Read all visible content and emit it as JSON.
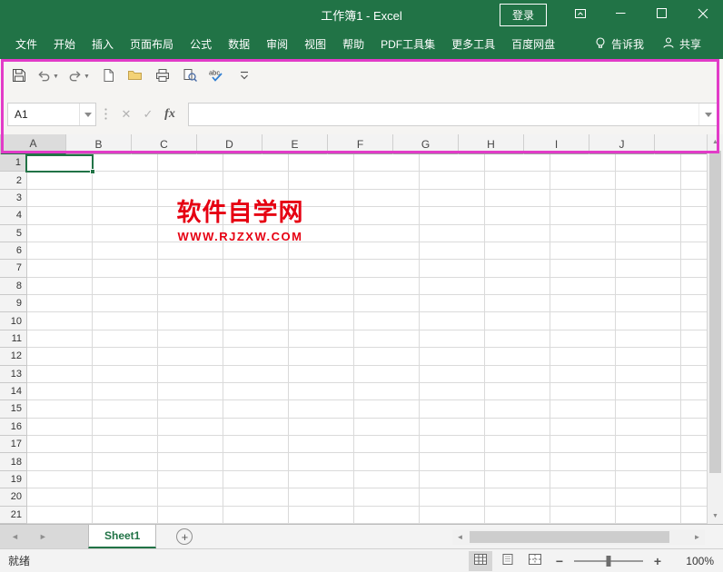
{
  "colors": {
    "accent_green": "#217346",
    "highlight_pink": "#e23bc8",
    "watermark_red": "#e60012"
  },
  "title_bar": {
    "title": "工作簿1 - Excel",
    "login_label": "登录"
  },
  "menu_bar": {
    "tabs": [
      {
        "name": "file",
        "label": "文件"
      },
      {
        "name": "home",
        "label": "开始"
      },
      {
        "name": "insert",
        "label": "插入"
      },
      {
        "name": "page-layout",
        "label": "页面布局"
      },
      {
        "name": "formulas",
        "label": "公式"
      },
      {
        "name": "data",
        "label": "数据"
      },
      {
        "name": "review",
        "label": "审阅"
      },
      {
        "name": "view",
        "label": "视图"
      },
      {
        "name": "help",
        "label": "帮助"
      },
      {
        "name": "pdf-tools",
        "label": "PDF工具集"
      },
      {
        "name": "more-tools",
        "label": "更多工具"
      },
      {
        "name": "baidu-netdisk",
        "label": "百度网盘"
      }
    ],
    "tell_me_label": "告诉我",
    "share_label": "共享"
  },
  "quick_access_toolbar": {
    "buttons": [
      "save",
      "undo",
      "redo",
      "new",
      "open",
      "quick-print",
      "print-preview",
      "spelling",
      "customize"
    ]
  },
  "formula_bar": {
    "name_box_value": "A1",
    "fx_label": "fx",
    "formula_value": ""
  },
  "grid": {
    "column_headers": [
      "A",
      "B",
      "C",
      "D",
      "E",
      "F",
      "G",
      "H",
      "I",
      "J"
    ],
    "row_numbers": [
      1,
      2,
      3,
      4,
      5,
      6,
      7,
      8,
      9,
      10,
      11,
      12,
      13,
      14,
      15,
      16,
      17,
      18,
      19,
      20,
      21
    ],
    "selected_cell": "A1"
  },
  "watermark": {
    "line1": "软件自学网",
    "line2": "WWW.RJZXW.COM"
  },
  "sheet_bar": {
    "tabs": [
      {
        "label": "Sheet1",
        "active": true
      }
    ],
    "add_sheet_label": "+"
  },
  "status_bar": {
    "status_text": "就绪",
    "zoom_label": "100%"
  }
}
